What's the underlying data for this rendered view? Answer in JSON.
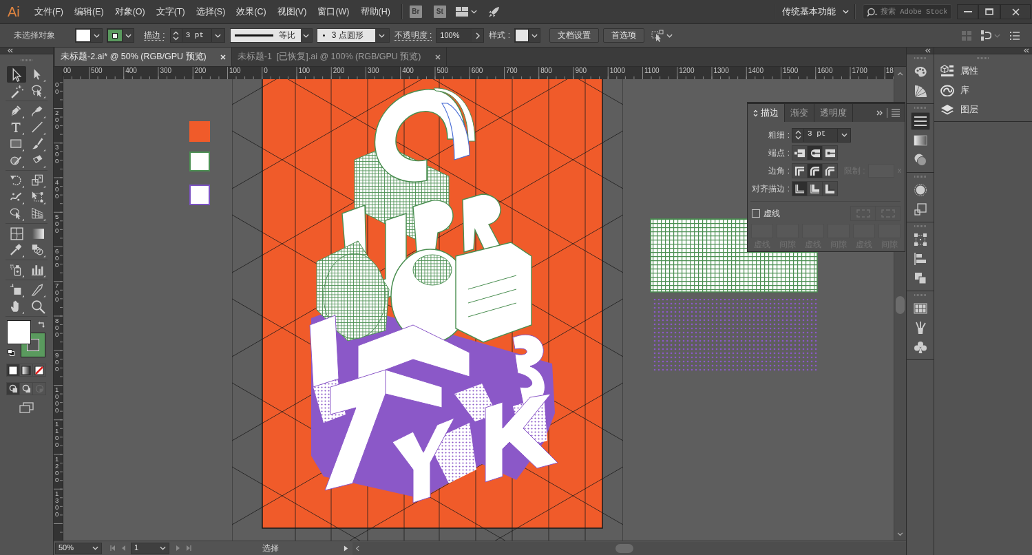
{
  "app": {
    "logo": "Ai",
    "menu": [
      "文件(F)",
      "编辑(E)",
      "对象(O)",
      "文字(T)",
      "选择(S)",
      "效果(C)",
      "视图(V)",
      "窗口(W)",
      "帮助(H)"
    ],
    "launchers": [
      "Br",
      "St"
    ],
    "workspace": "传统基本功能",
    "search": {
      "placeholder": "搜索 Adobe Stock"
    }
  },
  "control_bar": {
    "selection": "未选择对象",
    "fill": {
      "color": "#ffffff"
    },
    "stroke": {
      "color": "#5a9a5e"
    },
    "stroke_label": "描边 :",
    "stroke_weight": "3 pt",
    "profile": "等比",
    "brush": "3 点圆形",
    "opacity_label": "不透明度 :",
    "opacity": "100%",
    "style_label": "样式 :",
    "buttons": [
      "文档设置",
      "首选项"
    ]
  },
  "tabs": [
    {
      "label": "未标题-2.ai* @ 50% (RGB/GPU 预览)",
      "selected": true
    },
    {
      "label": "未标题-1  [已恢复].ai @ 100% (RGB/GPU 预览)",
      "selected": false
    }
  ],
  "rulers": {
    "horizontal": [
      "00",
      "500",
      "400",
      "300",
      "200",
      "100",
      "0",
      "100",
      "200",
      "300",
      "400",
      "500",
      "600",
      "700",
      "800",
      "900",
      "1000",
      "1100",
      "1200",
      "1300",
      "1400",
      "1500",
      "1600",
      "1700",
      "18"
    ],
    "vertical": [
      "00",
      "200",
      "300",
      "400",
      "500",
      "600",
      "700",
      "800",
      "900",
      "1000",
      "1100",
      "1200",
      "1300"
    ]
  },
  "toolbar": {
    "groups": [
      [
        {
          "kind": "selection",
          "selected": true
        },
        {
          "kind": "direct-selection",
          "selected": false
        },
        {
          "kind": "magic-wand",
          "selected": false
        },
        {
          "kind": "lasso",
          "selected": false
        }
      ],
      [
        {
          "kind": "pen",
          "selected": false
        },
        {
          "kind": "curvature",
          "selected": false
        },
        {
          "kind": "type",
          "selected": false
        },
        {
          "kind": "line",
          "selected": false
        },
        {
          "kind": "rectangle",
          "selected": false
        },
        {
          "kind": "paintbrush",
          "selected": false
        },
        {
          "kind": "shaper",
          "selected": false
        },
        {
          "kind": "eraser",
          "selected": false
        }
      ],
      [
        {
          "kind": "rotate",
          "selected": false
        },
        {
          "kind": "scale",
          "selected": false
        },
        {
          "kind": "width",
          "selected": false
        },
        {
          "kind": "free-transform",
          "selected": false
        },
        {
          "kind": "shape-builder",
          "selected": false
        },
        {
          "kind": "perspective-grid",
          "selected": false
        }
      ],
      [
        {
          "kind": "mesh",
          "selected": false
        },
        {
          "kind": "gradient",
          "selected": false
        },
        {
          "kind": "eyedropper",
          "selected": false
        },
        {
          "kind": "blend",
          "selected": false
        }
      ],
      [
        {
          "kind": "symbol-sprayer",
          "selected": false
        },
        {
          "kind": "column-graph",
          "selected": false
        }
      ],
      [
        {
          "kind": "artboard",
          "selected": false
        },
        {
          "kind": "slice",
          "selected": false
        },
        {
          "kind": "hand",
          "selected": false
        },
        {
          "kind": "zoom",
          "selected": false
        }
      ]
    ],
    "fill": {
      "color": "#ffffff"
    },
    "stroke": {
      "color": "#5a9a5e"
    },
    "color_modes": [
      {
        "kind": "color",
        "selected": true
      },
      {
        "kind": "gradient",
        "selected": false
      },
      {
        "kind": "none",
        "selected": false
      }
    ],
    "draw_modes": [
      {
        "kind": "normal",
        "selected": true,
        "disabled": false
      },
      {
        "kind": "behind",
        "selected": false,
        "disabled": false
      },
      {
        "kind": "inside",
        "selected": false,
        "disabled": true
      }
    ]
  },
  "stroke_panel": {
    "tabs": [
      {
        "label": "描边",
        "selected": true
      },
      {
        "label": "渐变",
        "selected": false
      },
      {
        "label": "透明度",
        "selected": false
      }
    ],
    "weight_label": "粗细 :",
    "weight": "3 pt",
    "cap_label": "端点 :",
    "caps": [
      {
        "kind": "butt",
        "selected": false
      },
      {
        "kind": "round",
        "selected": true
      },
      {
        "kind": "projecting",
        "selected": false
      }
    ],
    "corner_label": "边角 :",
    "corners": [
      {
        "kind": "miter",
        "selected": false
      },
      {
        "kind": "round",
        "selected": true
      },
      {
        "kind": "bevel",
        "selected": false
      }
    ],
    "limit_label": "限制 :",
    "limit_unit": "x",
    "align_label": "对齐描边 :",
    "aligns": [
      {
        "kind": "center",
        "selected": true
      },
      {
        "kind": "inside",
        "selected": false
      },
      {
        "kind": "outside",
        "selected": false
      }
    ],
    "dashed": {
      "label": "虚线",
      "checked": false
    },
    "dash_fields": [
      "虚线",
      "间隙",
      "虚线",
      "间隙",
      "虚线",
      "间隙"
    ]
  },
  "dock": [
    [
      {
        "kind": "color",
        "selected": false
      },
      {
        "kind": "color-guide",
        "selected": false
      }
    ],
    [
      {
        "kind": "stroke",
        "selected": true
      },
      {
        "kind": "gradient",
        "selected": false
      },
      {
        "kind": "transparency",
        "selected": false
      }
    ],
    [
      {
        "kind": "appearance",
        "selected": false
      },
      {
        "kind": "graphic-styles",
        "selected": false
      }
    ],
    [
      {
        "kind": "transform",
        "selected": false
      },
      {
        "kind": "align",
        "selected": false
      },
      {
        "kind": "pathfinder",
        "selected": false
      }
    ],
    [
      {
        "kind": "swatches",
        "selected": false
      },
      {
        "kind": "brushes",
        "selected": false
      },
      {
        "kind": "symbols",
        "selected": false
      }
    ]
  ],
  "panels": [
    {
      "kind": "properties",
      "label": "属性"
    },
    {
      "kind": "libraries",
      "label": "库"
    },
    {
      "kind": "layers",
      "label": "图层"
    }
  ],
  "status_bar": {
    "zoom": "50%",
    "page": "1",
    "tool": "选择"
  }
}
